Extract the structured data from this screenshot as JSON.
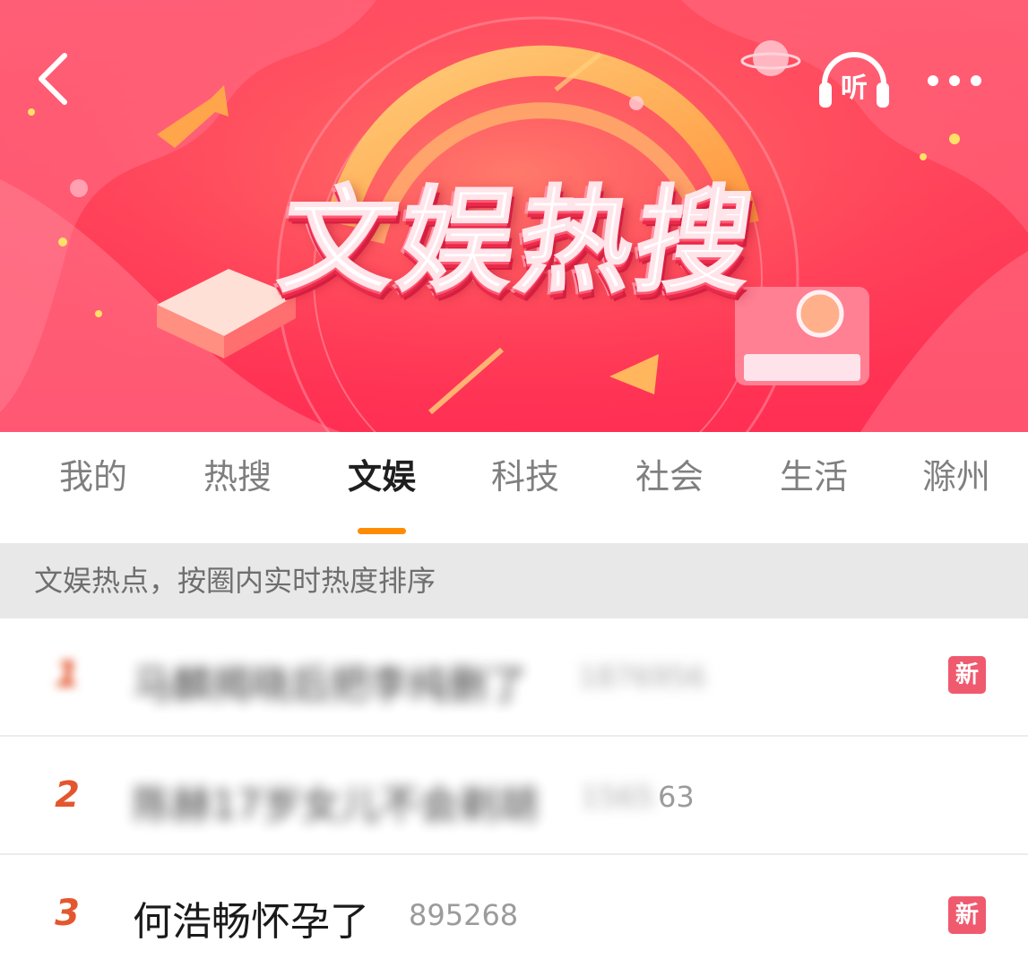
{
  "banner": {
    "title": "文娱热搜",
    "back_icon": "chevron-left-icon",
    "listen_label": "听",
    "listen_icon": "headphones-icon",
    "more_icon": "more-horizontal-icon"
  },
  "tabs": [
    {
      "label": "我的",
      "active": false
    },
    {
      "label": "热搜",
      "active": false
    },
    {
      "label": "文娱",
      "active": true
    },
    {
      "label": "科技",
      "active": false
    },
    {
      "label": "社会",
      "active": false
    },
    {
      "label": "生活",
      "active": false
    },
    {
      "label": "滁州",
      "active": false
    }
  ],
  "subtitle": "文娱热点，按圈内实时热度排序",
  "list": [
    {
      "rank": "1",
      "title": "马麟揭晓后把李纯删了",
      "heat": "1876956",
      "badge": "新",
      "blurred": true
    },
    {
      "rank": "2",
      "title": "陈赫17岁女儿不会剃胡",
      "heat": "1565563",
      "heat_visible_suffix": "63",
      "badge": "",
      "blurred": true
    },
    {
      "rank": "3",
      "title": "何浩畅怀孕了",
      "heat": "895268",
      "badge": "新",
      "blurred": false
    }
  ],
  "colors": {
    "banner_red": "#ff3b57",
    "accent_orange": "#ff8c00",
    "rank_red": "#e4572e",
    "badge_red": "#f05a6e"
  }
}
